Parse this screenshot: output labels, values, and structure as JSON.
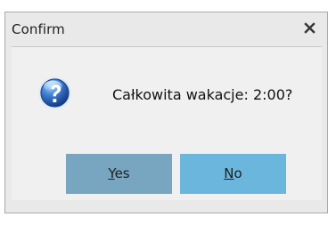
{
  "window": {
    "title": "Confirm"
  },
  "icons": {
    "close": "close-icon",
    "question": "question-icon"
  },
  "message": "Całkowita wakacje: 2:00?",
  "buttons": {
    "yes": {
      "first": "Y",
      "rest": "es"
    },
    "no": {
      "first": "N",
      "rest": "o"
    }
  },
  "colors": {
    "yes_button": "#78a5c0",
    "no_button": "#6ab6dd",
    "question_icon": "#2f63b8"
  }
}
